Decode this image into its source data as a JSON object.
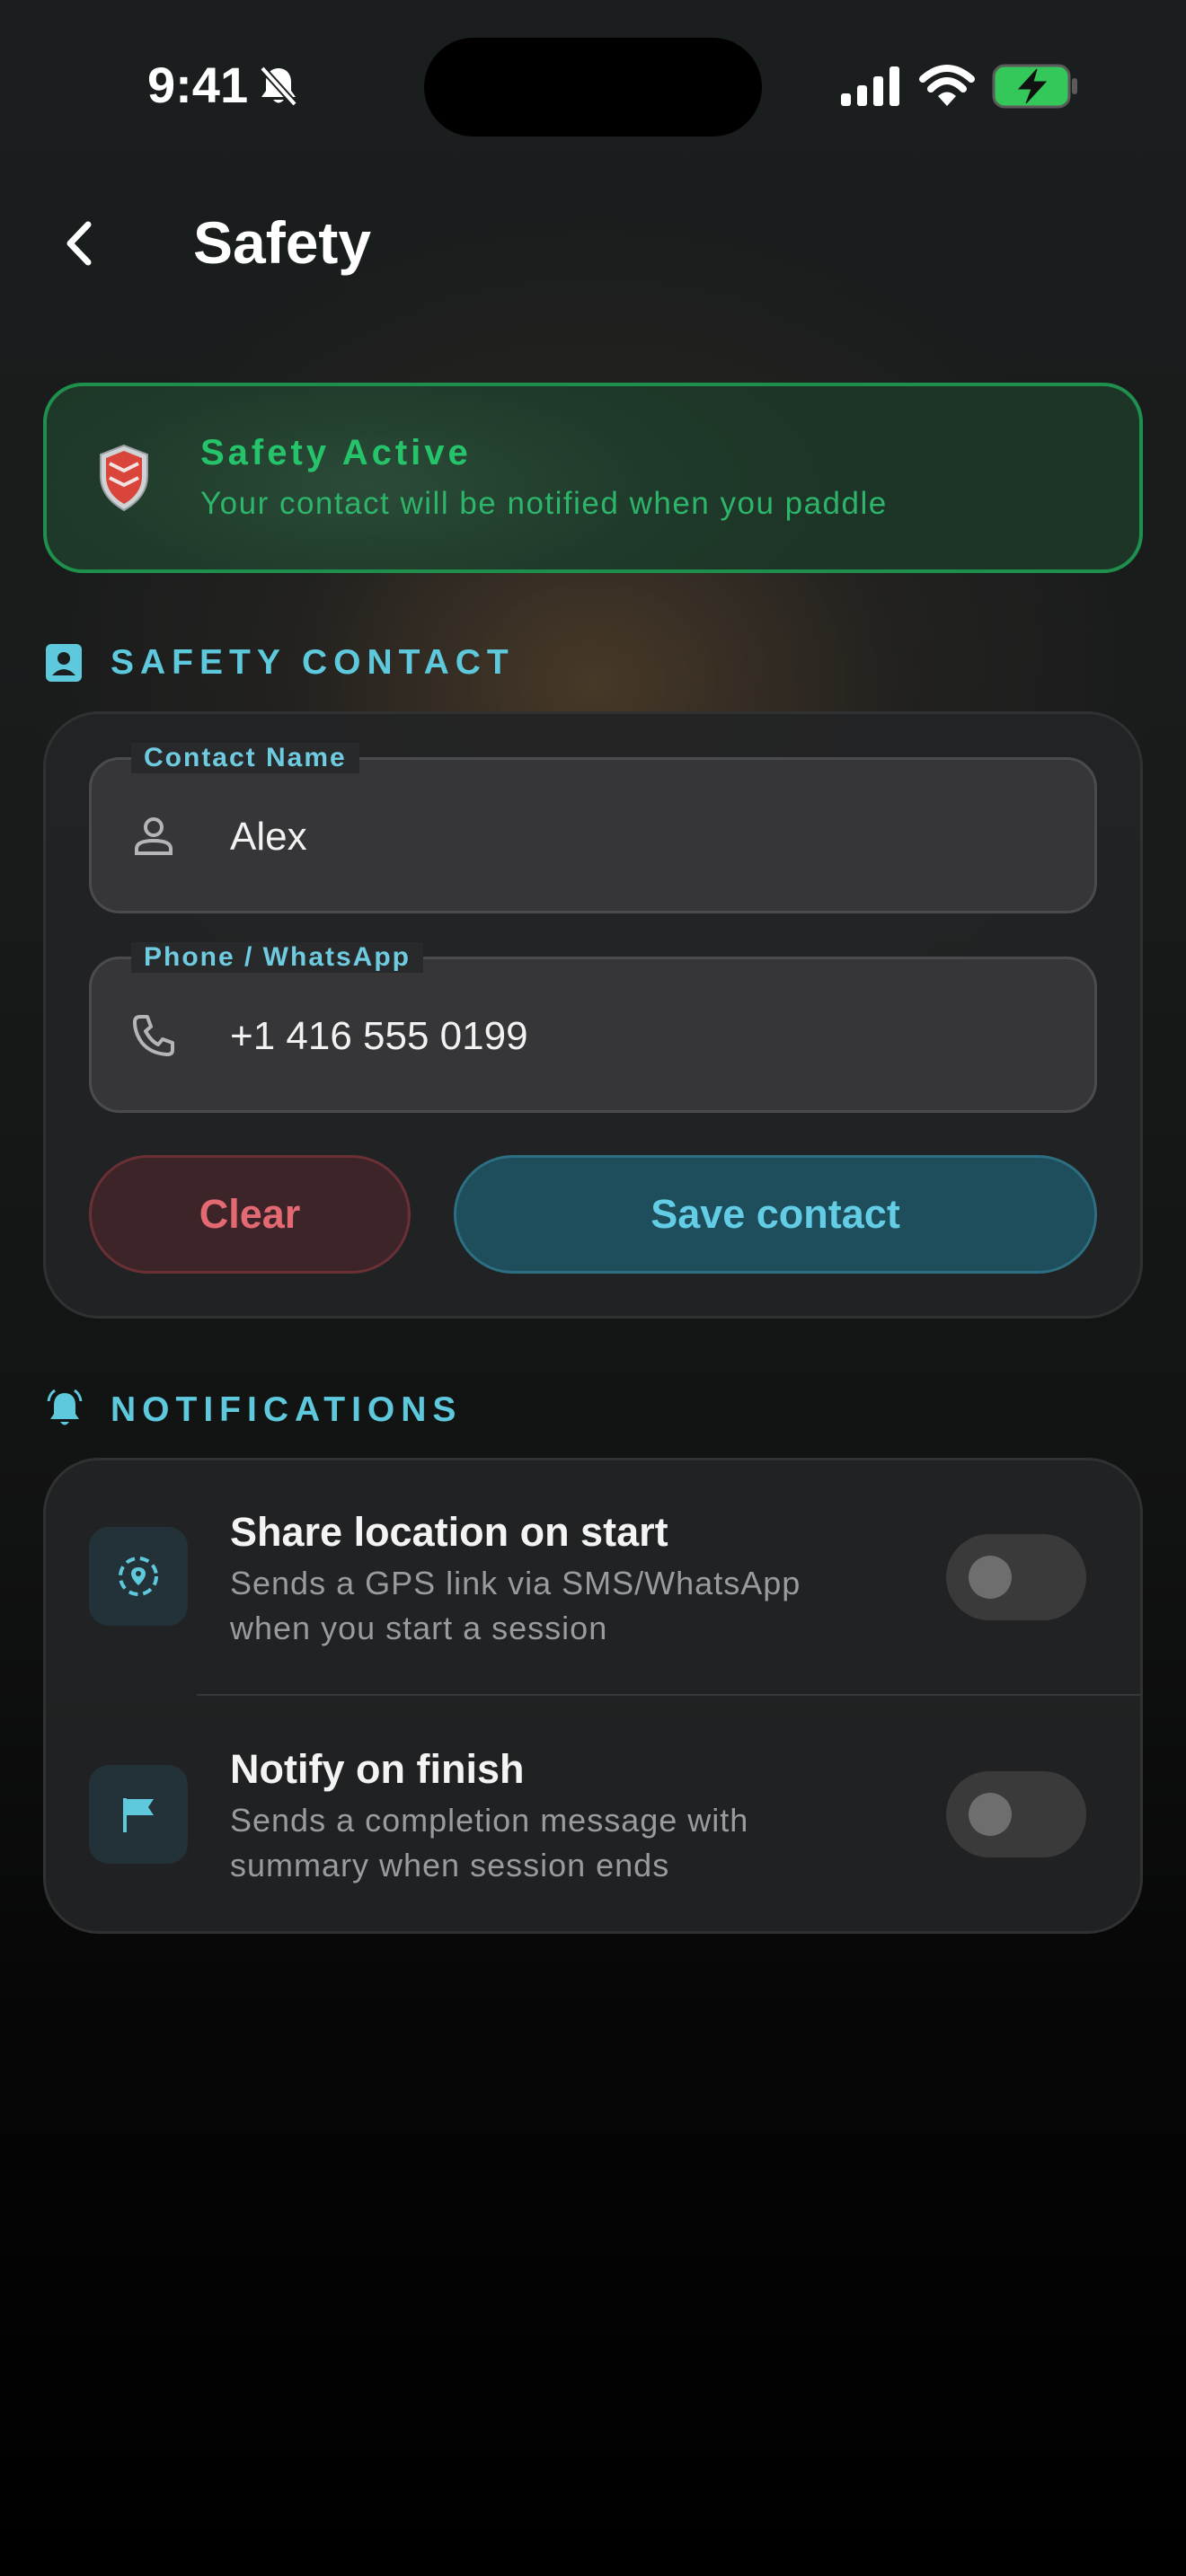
{
  "status_bar": {
    "time": "9:41",
    "icons": [
      "bell-slash-icon",
      "cellular-signal-icon",
      "wifi-icon",
      "battery-charging-icon"
    ],
    "battery_color": "#34c759"
  },
  "header": {
    "title": "Safety",
    "back_icon": "chevron-left-icon"
  },
  "banner": {
    "title": "Safety Active",
    "subtitle": "Your contact will be notified when you paddle",
    "icon": "shield-icon",
    "accent_color": "#26c46a"
  },
  "safety_contact": {
    "section_label": "SAFETY CONTACT",
    "section_icon": "contact-card-icon",
    "name_field": {
      "label": "Contact Name",
      "value": "Alex",
      "icon": "person-icon"
    },
    "phone_field": {
      "label": "Phone / WhatsApp",
      "value": "+1 416 555 0199",
      "icon": "phone-icon"
    },
    "clear_label": "Clear",
    "save_label": "Save contact"
  },
  "notifications": {
    "section_label": "NOTIFICATIONS",
    "section_icon": "bell-ringing-icon",
    "items": [
      {
        "title": "Share location on start",
        "description": "Sends a GPS link via SMS/WhatsApp when you start a session",
        "icon": "location-icon",
        "enabled": false
      },
      {
        "title": "Notify on finish",
        "description": "Sends a completion message with summary when session ends",
        "icon": "flag-icon",
        "enabled": false
      }
    ]
  },
  "colors": {
    "accent": "#5ec9dc",
    "danger": "#e36a72",
    "success": "#26c46a"
  }
}
